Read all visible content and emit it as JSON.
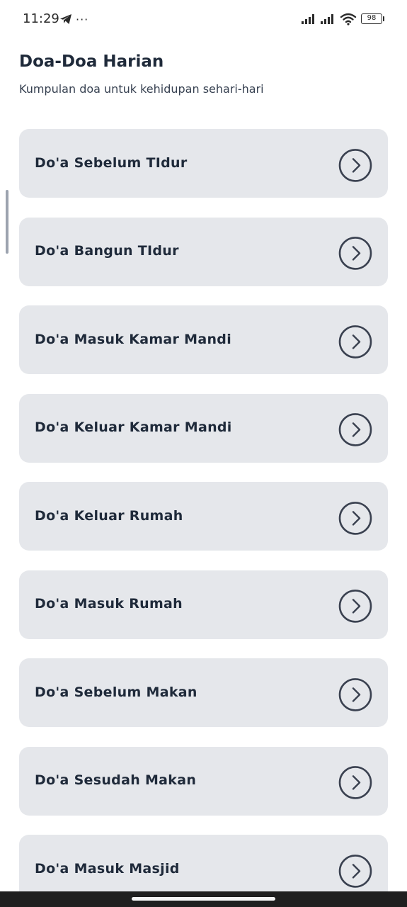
{
  "status_bar": {
    "time": "11:29",
    "more": "···",
    "battery": "98"
  },
  "header": {
    "title": "Doa-Doa Harian",
    "subtitle": "Kumpulan doa untuk kehidupan sehari-hari"
  },
  "prayers": [
    {
      "label": "Do'a Sebelum TIdur"
    },
    {
      "label": "Do'a Bangun TIdur"
    },
    {
      "label": "Do'a Masuk Kamar Mandi"
    },
    {
      "label": "Do'a Keluar Kamar Mandi"
    },
    {
      "label": "Do'a Keluar Rumah"
    },
    {
      "label": "Do'a Masuk Rumah"
    },
    {
      "label": "Do'a Sebelum Makan"
    },
    {
      "label": "Do'a Sesudah Makan"
    },
    {
      "label": "Do'a Masuk Masjid"
    }
  ],
  "icons": {
    "list_item": "chevron-right-circle-icon"
  },
  "colors": {
    "card_background": "#e5e7eb",
    "text_primary": "#1f2a3a",
    "icon_stroke": "#3a4150"
  }
}
